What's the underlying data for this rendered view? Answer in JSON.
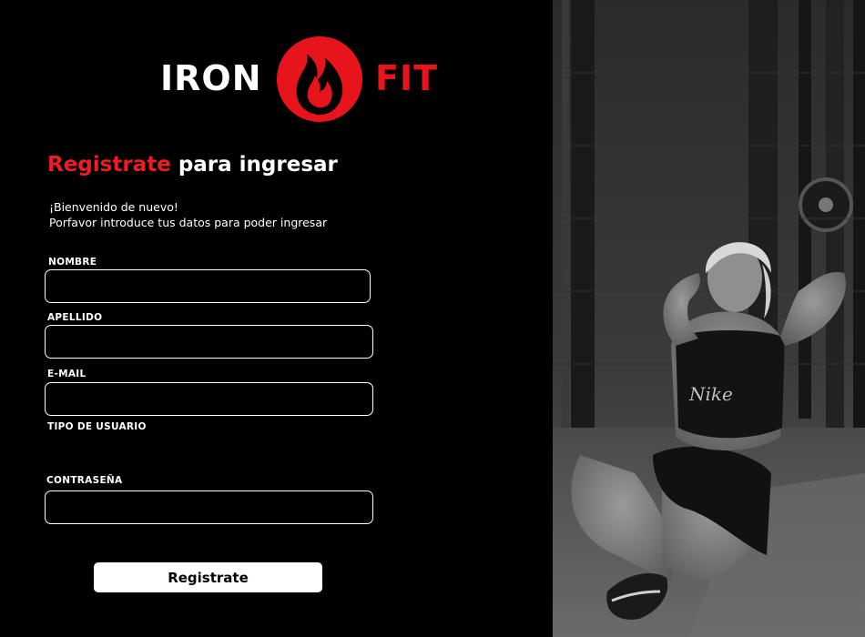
{
  "brand": {
    "left_word": "IRON",
    "right_word": "FIT",
    "accent_color": "#e8141b",
    "icon": "flame-icon"
  },
  "heading": {
    "accent": "Registrate",
    "rest": " para ingresar"
  },
  "welcome": {
    "line1": "¡Bienvenido de nuevo!",
    "line2": "Porfavor introduce tus datos para poder ingresar"
  },
  "form": {
    "nombre_label": "NOMBRE",
    "apellido_label": "APELLIDO",
    "email_label": "E-MAIL",
    "tipo_usuario_label": "TIPO DE USUARIO",
    "password_label": "CONTRASEÑA",
    "submit_label": "Registrate"
  },
  "hero": {
    "subject": "woman-doing-situps-photo",
    "shirt_text": "Nike",
    "style": "black-and-white"
  }
}
